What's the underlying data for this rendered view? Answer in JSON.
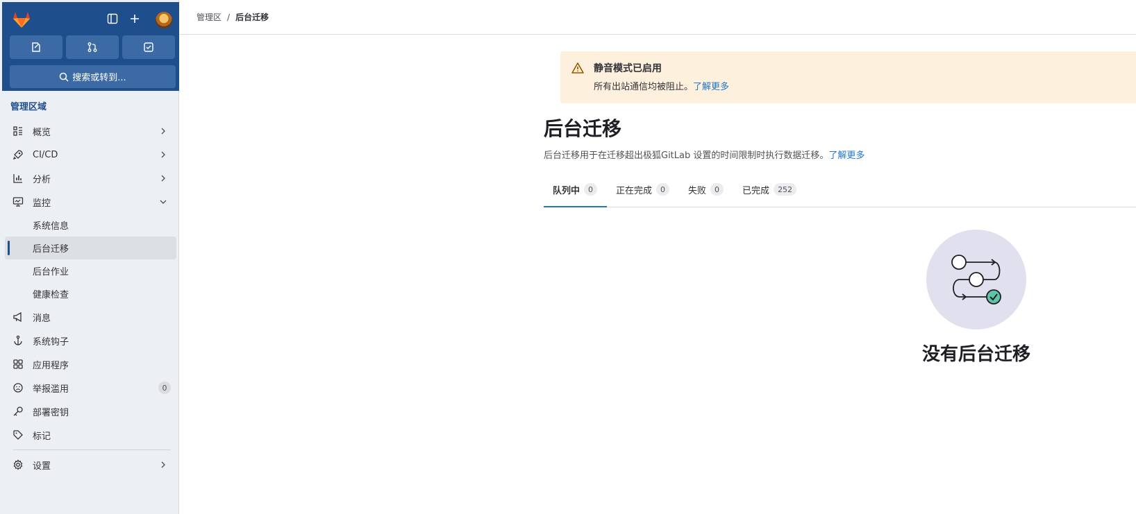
{
  "colors": {
    "sidebar_top": "#1f4e8c",
    "accent": "#1f75cb",
    "alert_bg": "#fdf1dd",
    "sidebar_bg": "#ecf0f5"
  },
  "sidebar": {
    "section_title": "管理区域",
    "search_placeholder": "搜索或转到...",
    "top_icons": [
      "sidebar-toggle-icon",
      "plus-icon"
    ],
    "shortcuts": [
      "issues-icon",
      "merge-request-icon",
      "todo-icon"
    ],
    "items": [
      {
        "label": "概览",
        "icon": "overview-icon",
        "chevron": "right"
      },
      {
        "label": "CI/CD",
        "icon": "rocket-icon",
        "chevron": "right"
      },
      {
        "label": "分析",
        "icon": "chart-icon",
        "chevron": "right"
      },
      {
        "label": "监控",
        "icon": "monitor-icon",
        "chevron": "down"
      }
    ],
    "sub_items": [
      {
        "label": "系统信息",
        "active": false
      },
      {
        "label": "后台迁移",
        "active": true
      },
      {
        "label": "后台作业",
        "active": false
      },
      {
        "label": "健康检查",
        "active": false
      }
    ],
    "items2": [
      {
        "label": "消息",
        "icon": "megaphone-icon"
      },
      {
        "label": "系统钩子",
        "icon": "anchor-icon"
      },
      {
        "label": "应用程序",
        "icon": "apps-icon"
      },
      {
        "label": "举报滥用",
        "icon": "abuse-icon",
        "badge": "0"
      },
      {
        "label": "部署密钥",
        "icon": "key-icon"
      },
      {
        "label": "标记",
        "icon": "label-icon"
      }
    ],
    "settings": {
      "label": "设置",
      "icon": "gear-icon"
    }
  },
  "breadcrumb": {
    "parent": "管理区",
    "separator": "/",
    "current": "后台迁移"
  },
  "alert": {
    "title": "静音模式已启用",
    "body": "所有出站通信均被阻止。",
    "link": "了解更多"
  },
  "page": {
    "title": "后台迁移",
    "description": "后台迁移用于在迁移超出极狐GitLab 设置的时间限制时执行数据迁移。",
    "desc_link": "了解更多"
  },
  "tabs": [
    {
      "label": "队列中",
      "count": "0",
      "active": true
    },
    {
      "label": "正在完成",
      "count": "0",
      "active": false
    },
    {
      "label": "失败",
      "count": "0",
      "active": false
    },
    {
      "label": "已完成",
      "count": "252",
      "active": false
    }
  ],
  "empty_state": {
    "title": "没有后台迁移"
  }
}
